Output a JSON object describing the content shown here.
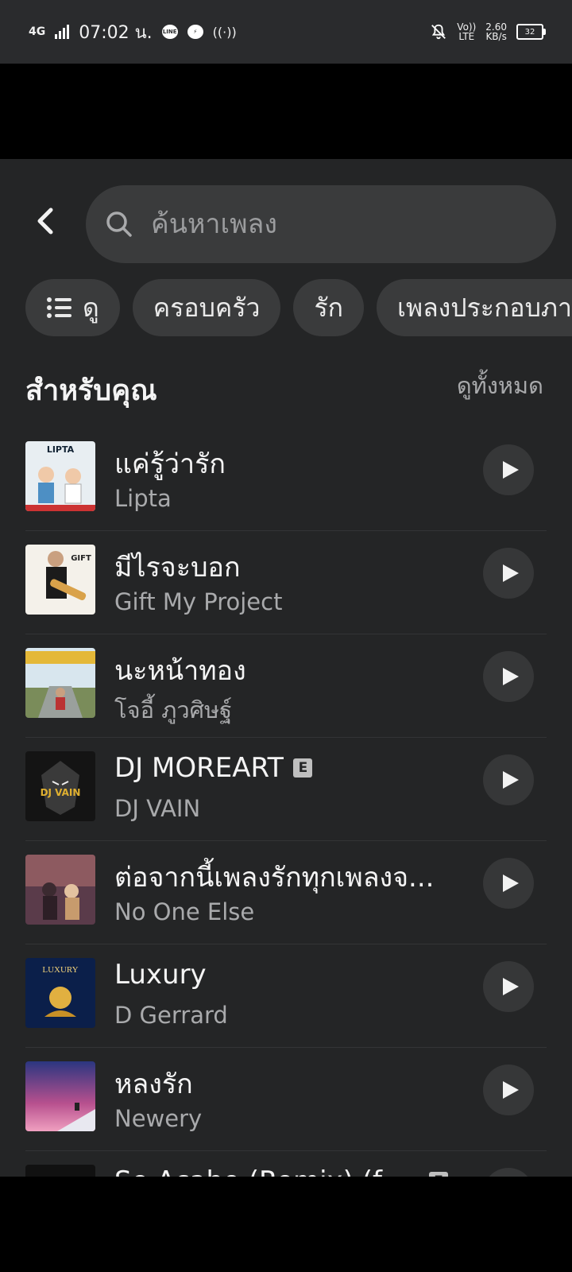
{
  "status_bar": {
    "network": "4G",
    "time": "07:02 น.",
    "volte_top": "Vo))",
    "volte_bottom": "LTE",
    "speed_value": "2.60",
    "speed_unit": "KB/s",
    "battery": "32"
  },
  "search": {
    "placeholder": "ค้นหาเพลง"
  },
  "chips": [
    {
      "label": "ดู"
    },
    {
      "label": "ครอบครัว"
    },
    {
      "label": "รัก"
    },
    {
      "label": "เพลงประกอบภาพยนตร์"
    }
  ],
  "section": {
    "title": "สำหรับคุณ",
    "see_all": "ดูทั้งหมด"
  },
  "songs": [
    {
      "title": "แค่รู้ว่ารัก",
      "artist": "Lipta",
      "explicit": false
    },
    {
      "title": "มีไรจะบอก",
      "artist": "Gift My Project",
      "explicit": false
    },
    {
      "title": "นะหน้าทอง",
      "artist": "โจอี้ ภูวศิษฐ์",
      "explicit": false
    },
    {
      "title": "DJ MOREART",
      "artist": "DJ VAIN",
      "explicit": true
    },
    {
      "title": "ต่อจากนี้เพลงรักทุกเพลงจ...",
      "artist": "No One Else",
      "explicit": false
    },
    {
      "title": "Luxury",
      "artist": "D Gerrard",
      "explicit": false
    },
    {
      "title": "หลงรัก",
      "artist": "Newery",
      "explicit": false
    },
    {
      "title": "Se Acabo (Remix) (feat...",
      "artist": "",
      "explicit": true
    }
  ],
  "explicit_badge": "E",
  "art_text": {
    "lipta": "LIPTA",
    "gift": "GIFT",
    "dj_vain": "DJ VAIN",
    "luxury": "LUXURY"
  },
  "colors": {
    "background": "#242526",
    "surface": "#3a3b3c",
    "text_primary": "#f4f4f4",
    "text_secondary": "#a9aaac"
  }
}
